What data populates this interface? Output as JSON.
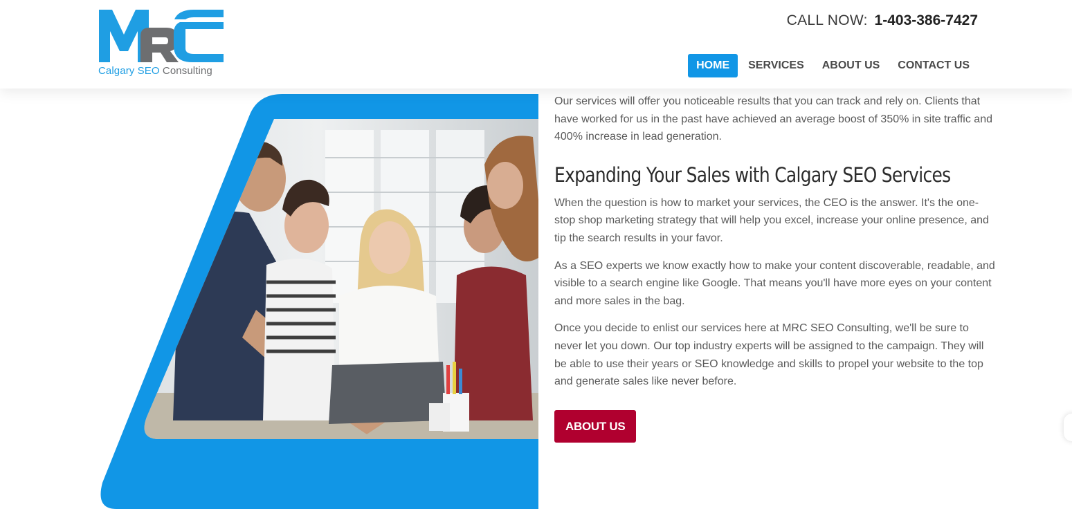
{
  "header": {
    "logo": {
      "letters": "MRC",
      "tagline_part1": "Calgary SEO",
      "tagline_part2": " Consulting"
    },
    "phone": {
      "label": "CALL NOW:",
      "number": "1-403-386-7427"
    },
    "nav": [
      {
        "label": "HOME",
        "active": true
      },
      {
        "label": "SERVICES",
        "active": false
      },
      {
        "label": "ABOUT US",
        "active": false
      },
      {
        "label": "CONTACT US",
        "active": false
      }
    ]
  },
  "main": {
    "intro": "Our services will offer you noticeable results that you can track and rely on. Clients that have worked for us in the past have achieved an average boost of 350% in site traffic and 400% increase in lead generation.",
    "heading": "Expanding Your Sales with Calgary SEO Services",
    "paragraphs": [
      "When the question is how to market your services, the CEO is the answer. It's the one-stop shop marketing strategy that will help you excel, increase your online presence, and tip the search results in your favor.",
      "As a SEO experts we know exactly how to make your content discoverable, readable, and visible to a search engine like Google. That means you'll have more eyes on your content and more sales in the bag.",
      "Once you decide to enlist our services here at MRC SEO Consulting, we'll be sure to never let you down. Our top industry experts will be assigned to the campaign. They will be able to use their years or SEO knowledge and skills to propel your website to the top and generate sales like never before."
    ],
    "cta_label": "ABOUT US"
  },
  "colors": {
    "brand_blue": "#1196e6",
    "logo_blue": "#1f9ee3",
    "logo_gray": "#6d6e70",
    "cta_red": "#b0002f"
  }
}
